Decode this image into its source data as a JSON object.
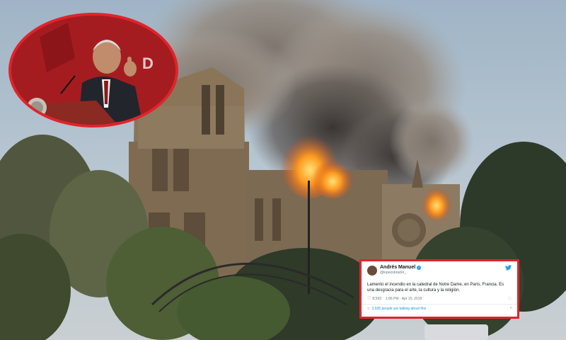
{
  "tweet": {
    "author_name": "Andrés Manuel",
    "handle": "@lopezobrador_",
    "text": "Lamento el incendio en la catedral de Notre Dame, en París, Francia. Es una desgracia para el arte, la cultura y la religión.",
    "likes": "8,593",
    "timestamp": "1:56 PM - Apr 15, 2019",
    "talking_about": "2,935 people are talking about this"
  },
  "inset": {
    "podium_text": "D"
  },
  "colors": {
    "highlight_border": "#e0242b",
    "twitter_blue": "#1da1f2"
  }
}
